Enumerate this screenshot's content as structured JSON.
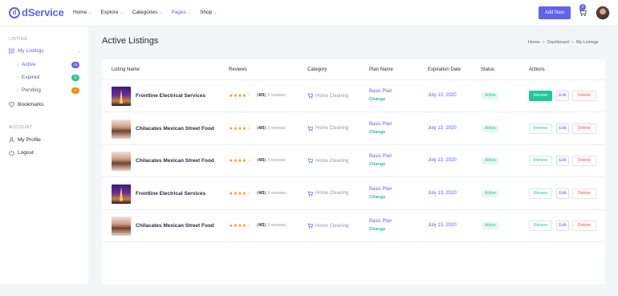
{
  "header": {
    "logo_text": "dService",
    "nav": [
      {
        "label": "Home",
        "active": false
      },
      {
        "label": "Explore",
        "active": false
      },
      {
        "label": "Categories",
        "active": false
      },
      {
        "label": "Pages",
        "active": true
      },
      {
        "label": "Shop",
        "active": false
      }
    ],
    "add_new_label": "Add New",
    "cart_count": "0",
    "icons": {
      "cart": "cart-icon",
      "avatar": "avatar"
    }
  },
  "sidebar": {
    "listing_section": "LISTING",
    "my_listings": "My Listings",
    "subitems": [
      {
        "label": "Active",
        "count": "15",
        "color": "#5f63f2",
        "active": true
      },
      {
        "label": "Expired",
        "count": "6",
        "color": "#20c997",
        "active": false
      },
      {
        "label": "Pending",
        "count": "2",
        "color": "#fa8b0c",
        "active": false
      }
    ],
    "bookmarks": "Bookmarks",
    "account_section": "ACCOUNT",
    "my_profile": "My Profile",
    "logout": "Logout"
  },
  "page": {
    "title": "Active Listings",
    "breadcrumb": [
      "Home",
      "Dashboard",
      "My Listings"
    ],
    "breadcrumb_sep": ">"
  },
  "table": {
    "columns": [
      "Listing Name",
      "Reviews",
      "Category",
      "Plan Name",
      "Expiration Date",
      "Status",
      "Actions"
    ],
    "rows": [
      {
        "name": "Frontline Electrical Services",
        "thumb": "tower",
        "stars": 4,
        "rating": "4/5",
        "reviews": "3 reviews",
        "category": "Home Cleaning",
        "plan": "Basic Plan",
        "change": "Change",
        "date": "July 13, 2020",
        "status": "Active",
        "renew_solid": true
      },
      {
        "name": "Chilacates Mexican Street Food",
        "thumb": "food",
        "stars": 4,
        "rating": "4/5",
        "reviews": "3 reviews",
        "category": "Home Cleaning",
        "plan": "Basic Plan",
        "change": "Change",
        "date": "July 13, 2020",
        "status": "Active",
        "renew_solid": false
      },
      {
        "name": "Chilacates Mexican Street Food",
        "thumb": "food",
        "stars": 4,
        "rating": "4/5",
        "reviews": "3 reviews",
        "category": "Home Cleaning",
        "plan": "Basic Plan",
        "change": "Change",
        "date": "July 13, 2020",
        "status": "Active",
        "renew_solid": false
      },
      {
        "name": "Frontline Electrical Services",
        "thumb": "tower",
        "stars": 4,
        "rating": "4/5",
        "reviews": "3 reviews",
        "category": "Home Cleaning",
        "plan": "Basic Plan",
        "change": "Change",
        "date": "July 13, 2020",
        "status": "Active",
        "renew_solid": false
      },
      {
        "name": "Chilacates Mexican Street Food",
        "thumb": "food",
        "stars": 4,
        "rating": "4/5",
        "reviews": "3 reviews",
        "category": "Home Cleaning",
        "plan": "Basic Plan",
        "change": "Change",
        "date": "July 13, 2020",
        "status": "Active",
        "renew_solid": false
      }
    ],
    "actions": {
      "renew": "Renew",
      "edit": "Edit",
      "delete": "Delete"
    }
  },
  "colors": {
    "primary": "#5f63f2",
    "success": "#20c997",
    "danger": "#ff4d4f",
    "warning": "#fa8b0c"
  }
}
